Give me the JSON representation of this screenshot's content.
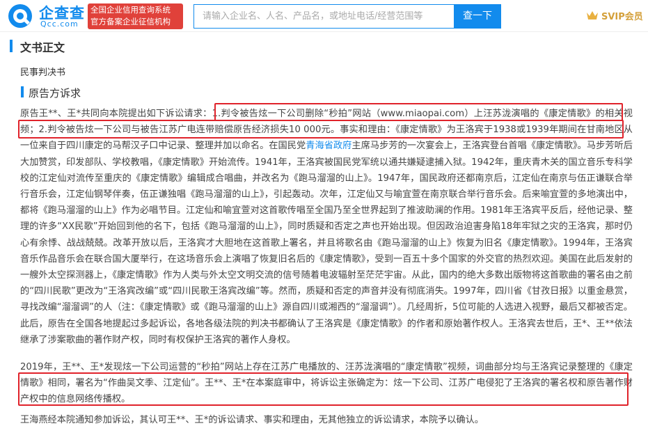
{
  "header": {
    "logo_cn": "企查查",
    "logo_en": "Qcc.com",
    "badge_line1": "全国企业信用查询系统",
    "badge_line2": "官方备案企业征信机构",
    "search_placeholder": "请输入企业名、人名、产品名，或地址电话/经营范围等",
    "search_button": "查一下",
    "vip_label": "SVIP会员"
  },
  "document": {
    "section_title": "文书正文",
    "doc_type": "民事判决书",
    "sub_section_title": "原告方诉求",
    "paragraphs": [
      {
        "segments": [
          {
            "text": "原告王**、王*共同向本院提出如下诉讼请求：1.判令被告炫一下公司删除“秒拍”网站（www.miaopai.com）上汪苏泷演唱的《康定情歌》的相关视频；2.判令被告炫一下公司与被告江苏广电连带赔偿原告经济损失10 000元。事实和理由：《康定情歌》为王洛宾于1938或1939年期间在甘南地区从一位来自于四川康定的马帮汉子口中记录、整理并加以命名。在国民党",
            "link": false
          },
          {
            "text": "青海省政府",
            "link": true
          },
          {
            "text": "主席马步芳的一次宴会上，王洛宾登台首唱《康定情歌》。马步芳听后大加赞赏，印发部队、学校教唱，《康定情歌》开始流传。1941年，王洛宾被国民党军统以通共嫌疑逮捕入狱。1942年，重庆青木关的国立音乐专科学校的江定仙对流传至重庆的《康定情歌》编辑成合唱曲，并改名为《跑马溜溜的山上》。1947年，国民政府还都南京后，江定仙在南京与伍正谦联合举行音乐会，江定仙钢琴伴奏，伍正谦独唱《跑马溜溜的山上》，引起轰动。次年，江定仙又与喻宜萱在南京联合举行音乐会。后来喻宜萱的多地演出中，都将《跑马溜溜的山上》作为必唱节目。江定仙和喻宜萱对这首歌传唱至全国乃至全世界起到了推波助澜的作用。1981年王洛宾平反后，经他记录、整理的许多“XX民歌”开始回到他的名下，包括《跑马溜溜的山上》，同时质疑和否定之声也开始出现。但因政治迫害身陷18年牢狱之灾的王洛宾，那时仍心有余悸、战战兢兢。改革开放以后，王洛宾才大胆地在这首歌上署名，并且将歌名由《跑马溜溜的山上》恢复为旧名《康定情歌》。1994年，王洛宾音乐作品音乐会在联合国大厦举行，在这场音乐会上演唱了恢复旧名后的《康定情歌》，受到一百五十多个国家的外交官的热烈欢迎。美国在此后发射的一艘外太空探测器上，《康定情歌》作为人类与外太空文明交流的信号随着电波辐射至茫茫宇宙。从此，国内的绝大多数出版物将这首歌曲的署名由之前的“四川民歌”更改为“王洛宾改编”或“四川民歌王洛宾改编”等。然而，质疑和否定的声音并没有彻底消失。1997年，四川省《甘孜日报》以重金悬赏，寻找改编“溜溜调”的人（注：《康定情歌》或《跑马溜溜的山上》源自四川或湘西的“溜溜调”）。几经周折，5位可能的人选进入视野，最后又都被否定。此后，原告在全国各地提起过多起诉讼，各地各级法院的判决书都确认了王洛宾是《康定情歌》的作者和原始著作权人。王洛宾去世后，王*、王**依法继承了涉案歌曲的著作财产权，同时有权保护王洛宾的著作人身权。",
            "link": false
          }
        ]
      },
      {
        "segments": [
          {
            "text": "2019年，王**、王*发现炫一下公司运营的“秒拍”网站上存在江苏广电播放的、汪苏泷演唱的“康定情歌”视频，词曲部分均与王洛宾记录整理的《康定情歌》相同，署名为“作曲吴文季、江定仙”。王**、王*在本案庭审中，将诉讼主张确定为：炫一下公司、江苏广电侵犯了王洛宾的署名权和原告著作财产权中的信息网络传播权。",
            "link": false
          }
        ]
      },
      {
        "segments": [
          {
            "text": "王海燕经本院通知参加诉讼，其认可王**、王*的诉讼请求、事实和理由，无其他独立的诉讼请求，本院予以确认。",
            "link": false
          }
        ]
      }
    ]
  },
  "colors": {
    "brand_blue": "#128bed",
    "badge_red": "#e0413a",
    "highlight_red": "#e0222a",
    "vip_gold": "#d4a03a"
  },
  "icons": {
    "logo": "qcc-logo-icon",
    "vip": "crown-icon"
  }
}
